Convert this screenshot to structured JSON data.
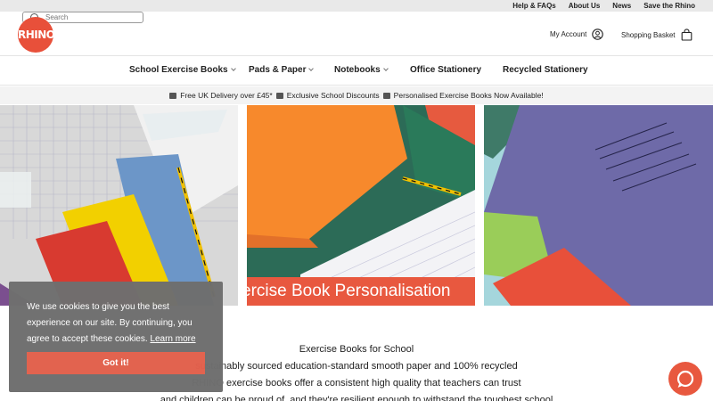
{
  "utility": {
    "links": [
      "Help & FAQs",
      "About Us",
      "News",
      "Save the Rhino"
    ]
  },
  "header": {
    "logo_text": "RHINO",
    "search_placeholder": "Search",
    "account_label": "My Account",
    "basket_label": "Shopping Basket"
  },
  "nav": {
    "items": [
      {
        "label": "School Exercise Books"
      },
      {
        "label": "Pads & Paper"
      },
      {
        "label": "Notebooks"
      },
      {
        "label": "Office Stationery"
      },
      {
        "label": "Recycled Stationery"
      }
    ]
  },
  "promo": {
    "items": [
      "Free UK Delivery over £45*",
      "Exclusive School Discounts",
      "Personalised Exercise Books Now Available!"
    ]
  },
  "hero": {
    "caption": "ercise Book Personalisation"
  },
  "intro": {
    "title": "Exercise Books for School",
    "line1": "sustainably sourced education-standard smooth paper and 100% recycled",
    "line2": "RHINO exercise books offer a consistent high quality that teachers can trust",
    "line3": "and children can be proud of, and they're resilient enough to withstand the toughest school"
  },
  "cookie": {
    "message": "We use cookies to give you the best experience on our site. By continuing, you agree to accept these cookies.",
    "learn_more": "Learn more",
    "button": "Got it!"
  },
  "colors": {
    "brand": "#e8503a",
    "utility_bg": "#e9e9e9",
    "cookie_bg": "#6f6f6f"
  }
}
